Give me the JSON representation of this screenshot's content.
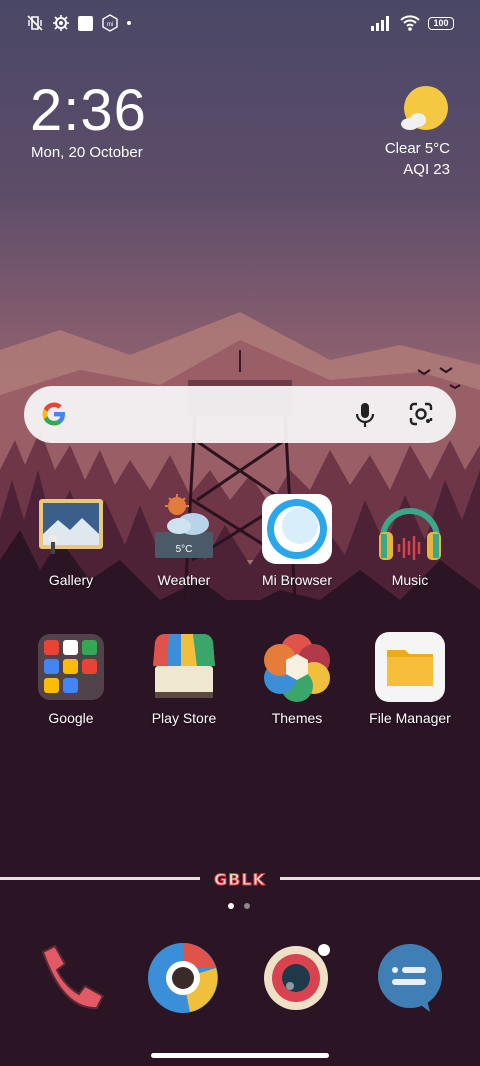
{
  "status_bar": {
    "icons_left": [
      "mute-vibrate-icon",
      "settings-cog-icon",
      "square-notification-icon",
      "mi-icon",
      "dot-icon"
    ],
    "icons_right": [
      "signal-icon",
      "wifi-icon"
    ],
    "battery": "100"
  },
  "clock": {
    "time": "2:36",
    "date": "Mon, 20 October"
  },
  "weather_widget": {
    "condition": "Clear   5°C",
    "aqi": "AQI 23"
  },
  "search": {
    "g_logo": "G"
  },
  "apps": [
    {
      "label": "Gallery"
    },
    {
      "label": "Weather",
      "icon_text": "5°C"
    },
    {
      "label": "Mi Browser"
    },
    {
      "label": "Music"
    },
    {
      "label": "Google"
    },
    {
      "label": "Play Store"
    },
    {
      "label": "Themes"
    },
    {
      "label": "File Manager"
    }
  ],
  "divider_text": "GBLK",
  "page_indicator": {
    "pages": 2,
    "current": 1
  },
  "dock": [
    "phone-icon",
    "chrome-icon",
    "camera-icon",
    "messages-icon"
  ]
}
